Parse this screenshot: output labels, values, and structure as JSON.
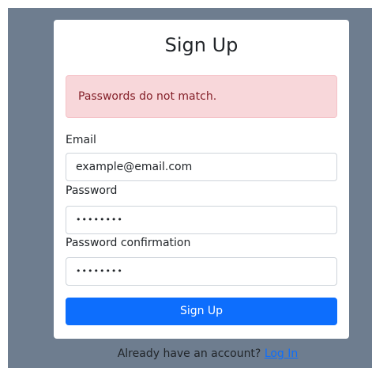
{
  "form": {
    "title": "Sign Up",
    "alert": "Passwords do not match.",
    "email_label": "Email",
    "email_value": "example@email.com",
    "password_label": "Password",
    "password_value": "••••••••",
    "password_confirmation_label": "Password confirmation",
    "password_confirmation_value": "••••••••",
    "submit_label": "Sign Up"
  },
  "footer": {
    "prompt": "Already have an account?",
    "login_link": "Log In"
  },
  "colors": {
    "backdrop": "#6e7d8f",
    "primary": "#0d6efd",
    "alert_bg": "#f8d7da",
    "alert_text": "#842029"
  }
}
